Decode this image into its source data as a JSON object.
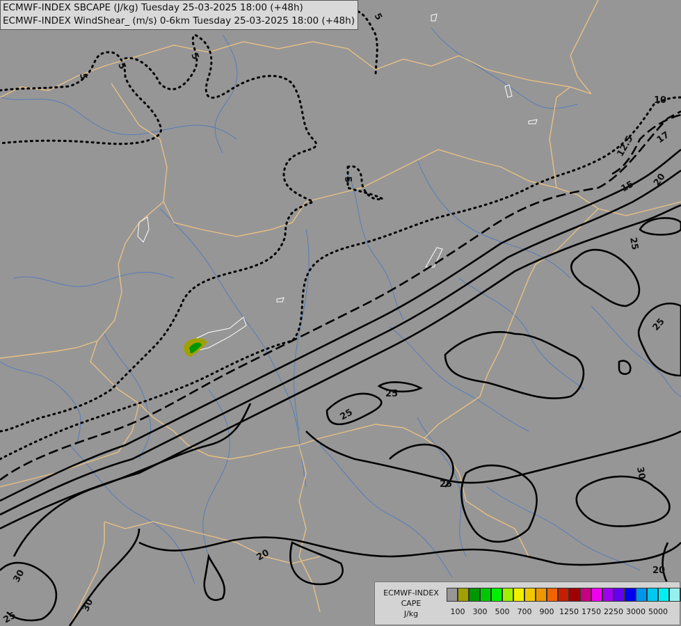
{
  "titles": {
    "line1": "ECMWF-INDEX SBCAPE (J/kg) Tuesday 25-03-2025 18:00 (+48h)",
    "line2": "ECMWF-INDEX WindShear_ (m/s) 0-6km Tuesday 25-03-2025 18:00 (+48h)"
  },
  "legend": {
    "model": "ECMWF-INDEX",
    "parameter": "CAPE",
    "unit": "J/kg",
    "colors": [
      "#969696",
      "#a0a000",
      "#009600",
      "#00c800",
      "#00f000",
      "#a0f000",
      "#f0f000",
      "#f0c800",
      "#f09600",
      "#f06400",
      "#c81e00",
      "#a00000",
      "#c80082",
      "#f000f0",
      "#a000f0",
      "#6400f0",
      "#0000f0",
      "#0096f0",
      "#00c8f0",
      "#00f0f0",
      "#96f0f0",
      "#ffffff"
    ],
    "tick_labels": [
      "100",
      "300",
      "500",
      "700",
      "900",
      "1250",
      "1750",
      "2250",
      "3000",
      "5000"
    ]
  },
  "contour_labels": {
    "l5a": "5",
    "l5b": "5",
    "l5c": "5",
    "l5d": "5",
    "l5e": "5",
    "l10": "10",
    "l125": "12.5",
    "l15": "15",
    "l17": "17",
    "l20a": "20",
    "l20b": "20",
    "l20c": "20",
    "l25a": "25",
    "l25b": "25",
    "l25c": "25",
    "l25d": "25",
    "l25e": "25",
    "l25f": "25",
    "l30a": "30",
    "l30b": "30",
    "l30c": "30"
  }
}
